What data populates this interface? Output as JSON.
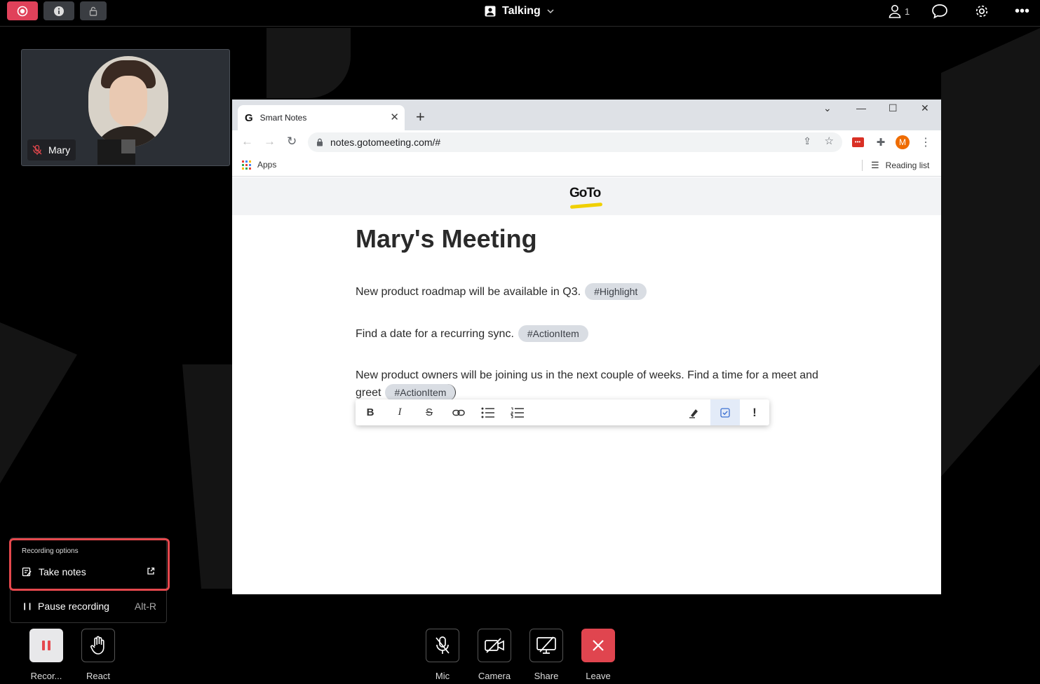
{
  "topbar": {
    "status_label": "Talking",
    "participants_count": "1"
  },
  "participant": {
    "name": "Mary"
  },
  "browser": {
    "tab_title": "Smart Notes",
    "url": "notes.gotomeeting.com/#",
    "bookmarks": {
      "apps_label": "Apps",
      "reading_list_label": "Reading list"
    },
    "profile_initial": "M"
  },
  "notes": {
    "logo_text": "GoTo",
    "title": "Mary's Meeting",
    "paragraphs": [
      {
        "text": "New product roadmap will be available in Q3.",
        "tag": "#Highlight"
      },
      {
        "text": "Find a date for a recurring sync.",
        "tag": "#ActionItem"
      },
      {
        "text": "New product owners will be joining us in the next couple of weeks. Find a time for a meet and greet",
        "tag": "#ActionItem"
      }
    ],
    "format_buttons": [
      "B",
      "I",
      "S",
      "link-icon",
      "bullet-list-icon",
      "numbered-list-icon",
      "highlighter-icon",
      "checkbox-icon",
      "!"
    ]
  },
  "recording_menu": {
    "header": "Recording options",
    "take_notes_label": "Take notes",
    "pause_label": "Pause recording",
    "pause_shortcut": "Alt-R"
  },
  "controls": {
    "recording_label": "Recor...",
    "react_label": "React",
    "mic_label": "Mic",
    "camera_label": "Camera",
    "share_label": "Share",
    "leave_label": "Leave"
  },
  "colors": {
    "record_accent": "#e5484d",
    "leave": "#e0454f",
    "tag_bg": "#d9dde3"
  }
}
